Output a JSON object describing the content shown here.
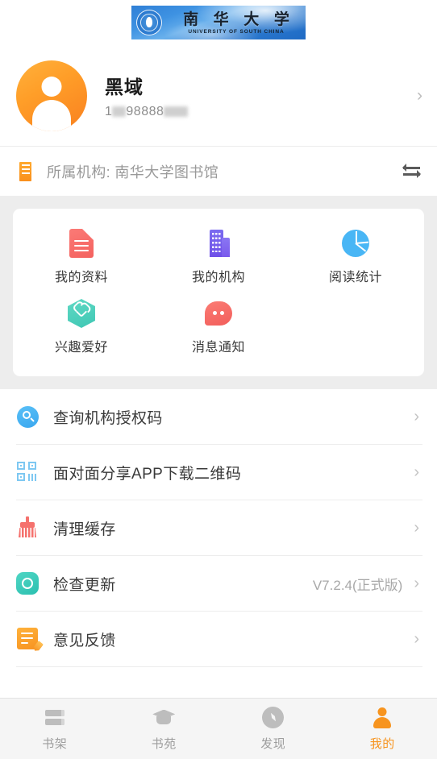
{
  "banner": {
    "cn_name": "南 华 大 学",
    "en_name": "UNIVERSITY OF SOUTH CHINA",
    "emblem_icon": "university-emblem-icon"
  },
  "profile": {
    "avatar_icon": "avatar-person-icon",
    "user_name": "黑域",
    "phone_prefix": "1",
    "phone_middle": "98888",
    "chevron": "›"
  },
  "organization": {
    "icon": "building-icon",
    "label": "所属机构: 南华大学图书馆",
    "switch_icon": "swap-arrows-icon"
  },
  "grid": [
    {
      "label": "我的资料",
      "icon": "document-icon"
    },
    {
      "label": "我的机构",
      "icon": "building-purple-icon"
    },
    {
      "label": "阅读统计",
      "icon": "pie-chart-icon"
    },
    {
      "label": "兴趣爱好",
      "icon": "heart-hexagon-icon"
    },
    {
      "label": "消息通知",
      "icon": "chat-bubble-icon"
    }
  ],
  "settings": [
    {
      "label": "查询机构授权码",
      "value": "",
      "icon": "search-icon",
      "chevron": "›"
    },
    {
      "label": "面对面分享APP下载二维码",
      "value": "",
      "icon": "qrcode-icon",
      "chevron": "›"
    },
    {
      "label": "清理缓存",
      "value": "",
      "icon": "broom-icon",
      "chevron": "›"
    },
    {
      "label": "检查更新",
      "value": "V7.2.4(正式版)",
      "icon": "refresh-icon",
      "chevron": "›"
    },
    {
      "label": "意见反馈",
      "value": "",
      "icon": "feedback-edit-icon",
      "chevron": "›"
    }
  ],
  "tabbar": [
    {
      "label": "书架",
      "icon": "bookshelf-icon",
      "active": false
    },
    {
      "label": "书苑",
      "icon": "graduation-cap-icon",
      "active": false
    },
    {
      "label": "发现",
      "icon": "compass-icon",
      "active": false
    },
    {
      "label": "我的",
      "icon": "person-icon",
      "active": true
    }
  ],
  "colors": {
    "accent_orange": "#f7941e",
    "banner_blue": "#2a79cf",
    "inactive_gray": "#9e9e9e",
    "page_bg": "#ededed"
  }
}
